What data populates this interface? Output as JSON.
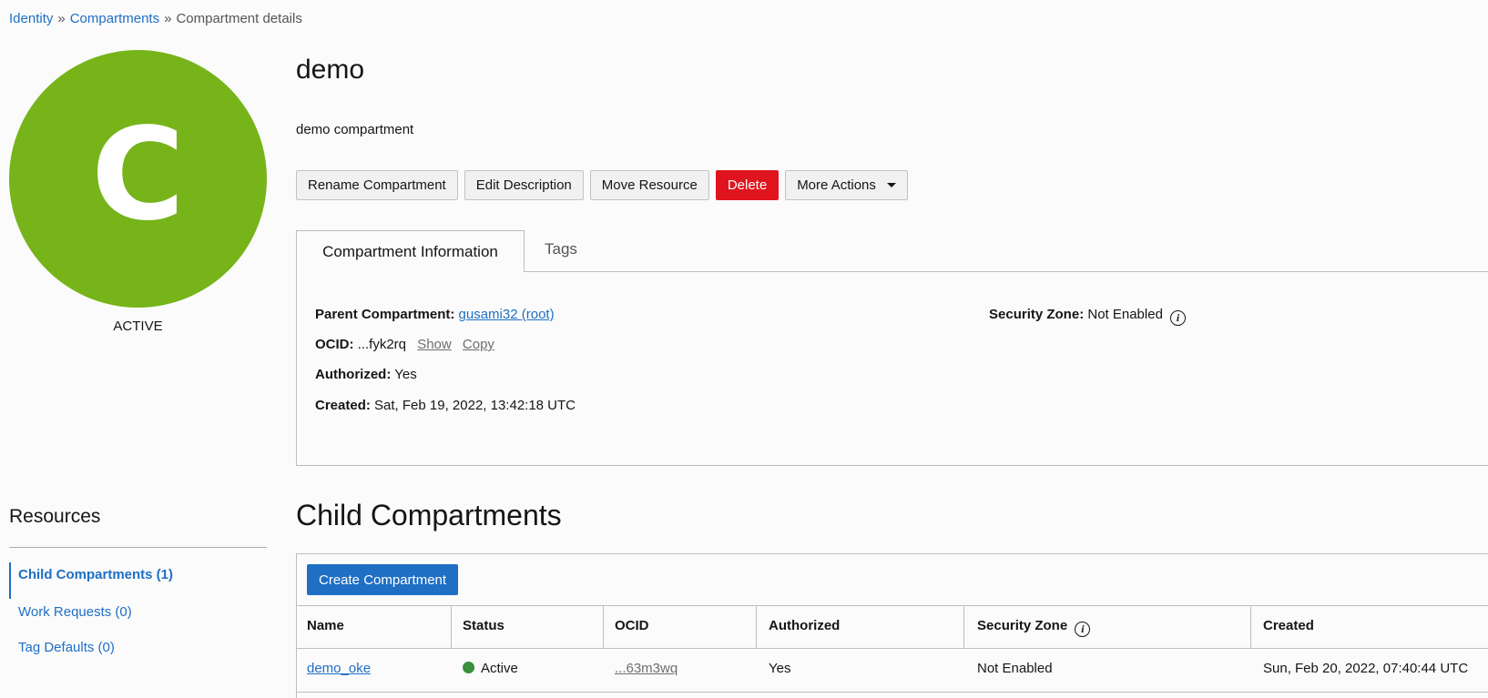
{
  "breadcrumb": {
    "items": [
      "Identity",
      "Compartments",
      "Compartment details"
    ],
    "separator": "»"
  },
  "avatar": {
    "letter": "C",
    "status": "ACTIVE",
    "color": "#76b41a"
  },
  "compartment": {
    "name": "demo",
    "description": "demo compartment"
  },
  "actions": {
    "rename": "Rename Compartment",
    "edit_description": "Edit Description",
    "move": "Move Resource",
    "delete": "Delete",
    "more": "More Actions"
  },
  "tabs": {
    "info": "Compartment Information",
    "tags": "Tags"
  },
  "info": {
    "parent_label": "Parent Compartment:",
    "parent_value": "gusami32 (root)",
    "ocid_label": "OCID:",
    "ocid_value": "...fyk2rq",
    "show": "Show",
    "copy": "Copy",
    "authorized_label": "Authorized:",
    "authorized_value": "Yes",
    "created_label": "Created:",
    "created_value": "Sat, Feb 19, 2022, 13:42:18 UTC",
    "security_label": "Security Zone:",
    "security_value": "Not Enabled",
    "info_icon": "info-icon"
  },
  "resources": {
    "title": "Resources",
    "items": [
      "Child Compartments (1)",
      "Work Requests (0)",
      "Tag Defaults (0)"
    ]
  },
  "child": {
    "title": "Child Compartments",
    "create_button": "Create Compartment",
    "columns": [
      "Name",
      "Status",
      "OCID",
      "Authorized",
      "Security Zone",
      "Created"
    ],
    "rows": [
      {
        "name": "demo_oke",
        "status": "Active",
        "ocid": "...63m3wq",
        "authorized": "Yes",
        "security_zone": "Not Enabled",
        "created": "Sun, Feb 20, 2022, 07:40:44 UTC"
      }
    ]
  },
  "colors": {
    "accent": "#1f6fc4",
    "danger": "#e0141e",
    "active_status": "#3a8f3a"
  }
}
